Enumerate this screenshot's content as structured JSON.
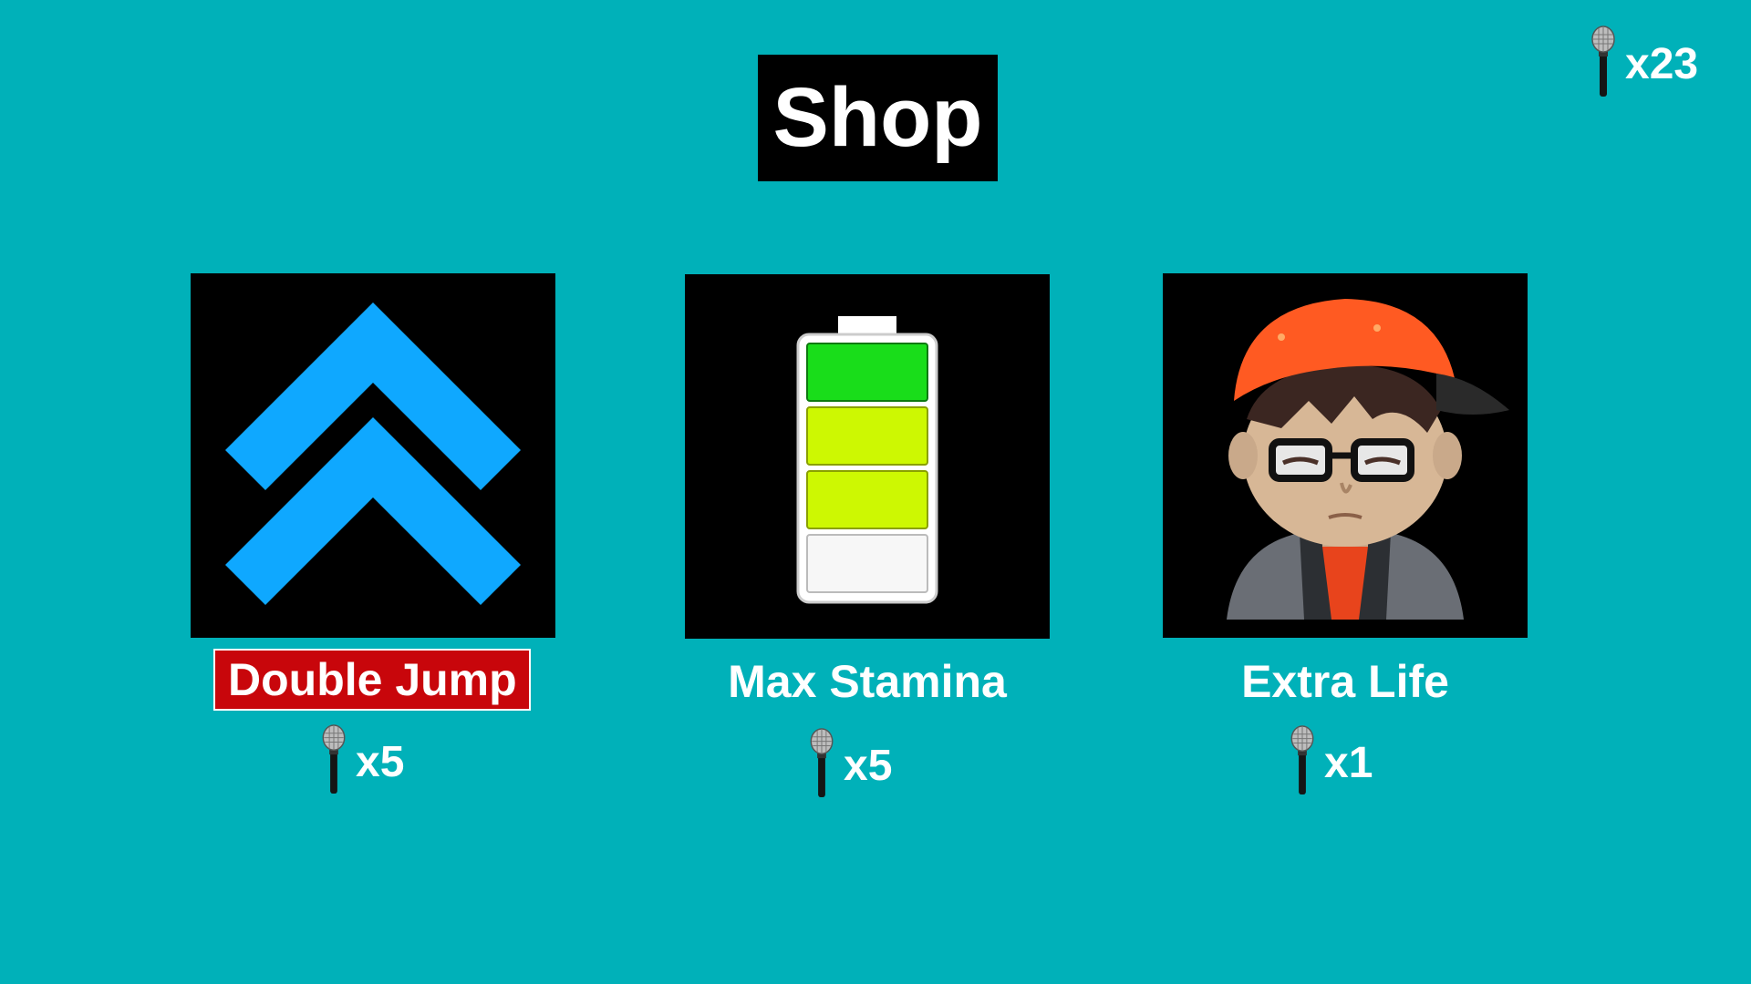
{
  "header": {
    "title": "Shop"
  },
  "currency": {
    "icon": "microphone-icon",
    "count": "x23"
  },
  "items": [
    {
      "name": "Double Jump",
      "price": "x5",
      "icon": "double-chevron-up-icon",
      "selected": true
    },
    {
      "name": "Max Stamina",
      "price": "x5",
      "icon": "battery-icon",
      "selected": false
    },
    {
      "name": "Extra Life",
      "price": "x1",
      "icon": "character-portrait-icon",
      "selected": false
    }
  ],
  "colors": {
    "background": "#00b1b9",
    "tile": "#000000",
    "selection": "#c8060b",
    "chevron": "#0fa8ff",
    "battery_green": "#19dd1a",
    "battery_yellow": "#cdf802",
    "cap": "#ff5a22"
  }
}
